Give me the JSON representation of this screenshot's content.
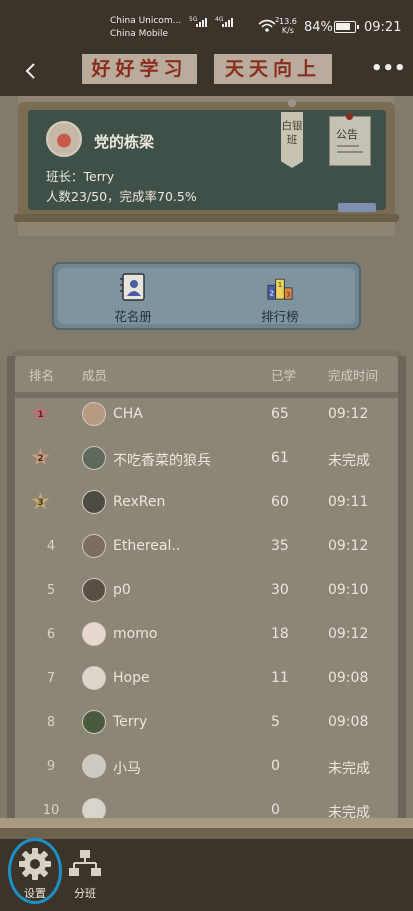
{
  "status_bar": {
    "carrier_1": "China Unicom...",
    "carrier_2": "China Mobile",
    "net_1": "5G",
    "net_2": "4G",
    "wifi_num": "2",
    "speed_value": "13.6",
    "speed_unit": "K/s",
    "battery": "84%",
    "battery_level": 0.84,
    "time": "09:21"
  },
  "title_bar": {
    "back_icon": "chevron-left-icon",
    "title_left": "好好学习",
    "title_right": "天天向上",
    "more_icon": "more-icon",
    "more_label": "•••"
  },
  "class_board": {
    "class_name": "党的栋梁",
    "monitor": "班长：Terry",
    "stats": "人数23/50，完成率70.5%",
    "tag": "白银班",
    "notice": "公告"
  },
  "functions": [
    {
      "label": "花名册",
      "icon": "roster-book-icon"
    },
    {
      "label": "排行榜",
      "icon": "podium-icon",
      "podium": [
        "2",
        "1",
        "3"
      ]
    }
  ],
  "ranking": {
    "headers": {
      "rank": "排名",
      "member": "成员",
      "learned": "已学",
      "time": "完成时间"
    },
    "rows": [
      {
        "rank": "1",
        "name": "CHA",
        "learned": "65",
        "time": "09:12",
        "medal": "#c76b78"
      },
      {
        "rank": "2",
        "name": "不吃香菜的狼兵",
        "learned": "61",
        "time": "未完成",
        "medal": "#d29a7b"
      },
      {
        "rank": "3",
        "name": "RexRen",
        "learned": "60",
        "time": "09:11",
        "medal": "#c9a96b"
      },
      {
        "rank": "4",
        "name": "Ethereal..",
        "learned": "35",
        "time": "09:12"
      },
      {
        "rank": "5",
        "name": "p0",
        "learned": "30",
        "time": "09:10"
      },
      {
        "rank": "6",
        "name": "momo",
        "learned": "18",
        "time": "09:12"
      },
      {
        "rank": "7",
        "name": "Hope",
        "learned": "11",
        "time": "09:08"
      },
      {
        "rank": "8",
        "name": "Terry",
        "learned": "5",
        "time": "09:08"
      },
      {
        "rank": "9",
        "name": "小马",
        "learned": "0",
        "time": "未完成"
      },
      {
        "rank": "10",
        "name": "",
        "learned": "0",
        "time": "未完成"
      }
    ]
  },
  "bottom_bar": {
    "settings_label": "设置",
    "settings_icon": "gear-icon",
    "divide_label": "分班",
    "divide_icon": "org-chart-icon"
  },
  "colors": {
    "highlight": "#1d8fc9",
    "title_text": "#8b2d1e",
    "board": "#3f5048"
  }
}
